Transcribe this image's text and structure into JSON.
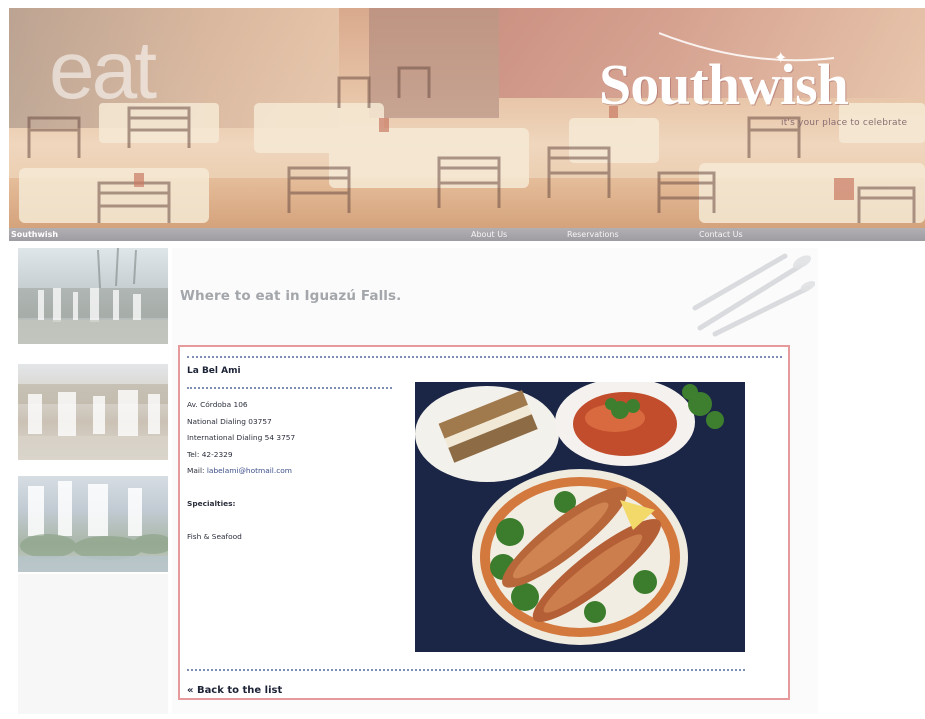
{
  "header": {
    "watermark_text": "eat",
    "brand": "Southwish",
    "tagline": "it's your place to celebrate"
  },
  "nav": {
    "brand_link": "Southwish",
    "links": [
      "About Us",
      "Reservations",
      "Contact Us"
    ]
  },
  "main": {
    "heading": "Where to eat in Iguazú Falls.",
    "restaurant": {
      "name": "La Bel Ami",
      "address": "Av. Córdoba 106",
      "national_dialing": "National Dialing 03757",
      "international_dialing": "International Dialing 54 3757",
      "tel": "Tel: 42-2329",
      "mail_label": "Mail: ",
      "mail_address": "labelami@hotmail.com",
      "specialties_heading": "Specialties:",
      "specialties_value": "Fish & Seafood"
    },
    "back_link": "« Back to the list"
  },
  "colors": {
    "card_border": "#e79a9b",
    "nav_bar": "#a9a7ac",
    "heading_text": "#a3a6aa",
    "dotted_rule": "#7f8fb3"
  }
}
